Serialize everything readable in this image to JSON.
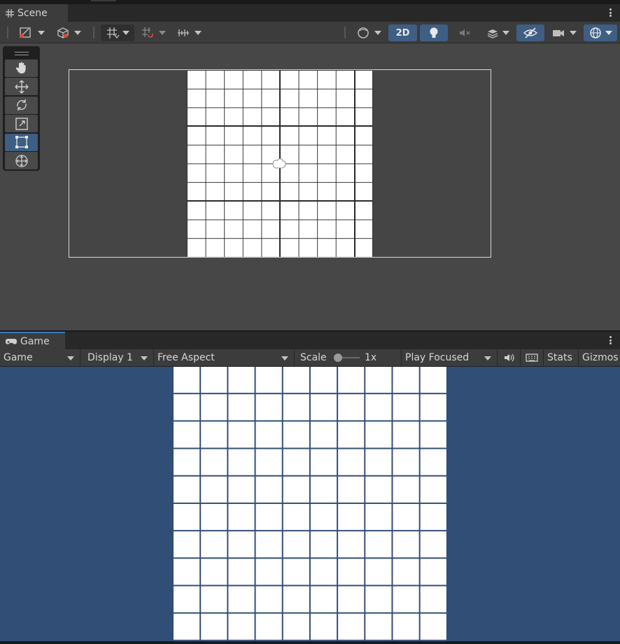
{
  "scene_panel": {
    "tab_label": "Scene",
    "tab_icon": "grid-hash-icon",
    "toolbar": {
      "mode_2d_label": "2D"
    },
    "tools": [
      "hand-tool",
      "move-tool",
      "rotate-tool",
      "scale-tool",
      "rect-tool",
      "transform-tool"
    ],
    "active_tool": "rect-tool",
    "accent_color": "#3e5e83"
  },
  "game_panel": {
    "tab_label": "Game",
    "tab_icon": "gamepad-icon",
    "toolbar": {
      "view_select": "Game",
      "display_select": "Display 1",
      "aspect_select": "Free Aspect",
      "scale_label": "Scale",
      "scale_value": "1x",
      "play_mode_select": "Play Focused",
      "stats_label": "Stats",
      "gizmos_label": "Gizmos"
    },
    "background_color": "#314e77"
  },
  "grid": {
    "rows": 10,
    "columns": 10
  }
}
